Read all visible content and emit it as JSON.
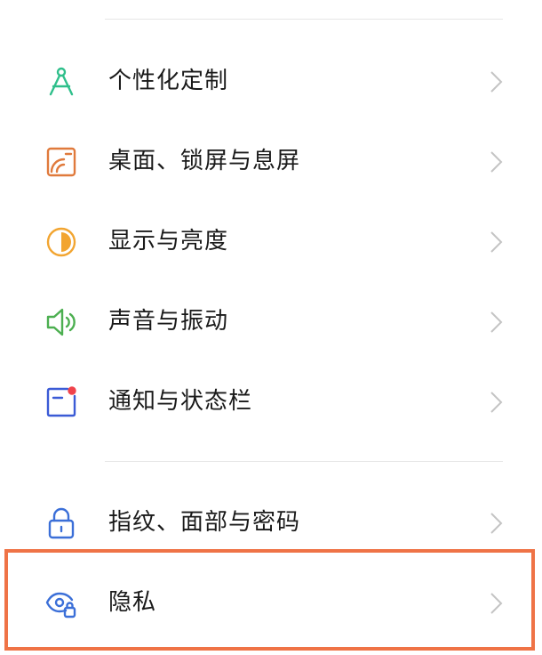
{
  "settings": {
    "items": [
      {
        "label": "个性化定制",
        "icon": "personalization-compass-icon",
        "color": "#2fbf8b"
      },
      {
        "label": "桌面、锁屏与息屏",
        "icon": "wallpaper-icon",
        "color": "#e07a3c"
      },
      {
        "label": "显示与亮度",
        "icon": "brightness-icon",
        "color": "#f2a531"
      },
      {
        "label": "声音与振动",
        "icon": "speaker-icon",
        "color": "#4caf50"
      },
      {
        "label": "通知与状态栏",
        "icon": "notification-icon",
        "color": "#3b5bd6",
        "badge_color": "#f0434b"
      },
      {
        "label": "指纹、面部与密码",
        "icon": "lock-icon",
        "color": "#3b6fd8"
      },
      {
        "label": "隐私",
        "icon": "privacy-eye-icon",
        "color": "#3b6fd8"
      }
    ]
  },
  "highlight": {
    "target": "隐私",
    "color": "#ef7346"
  },
  "chevron_color": "#c4c4c4",
  "divider_color": "#e6e6e6"
}
